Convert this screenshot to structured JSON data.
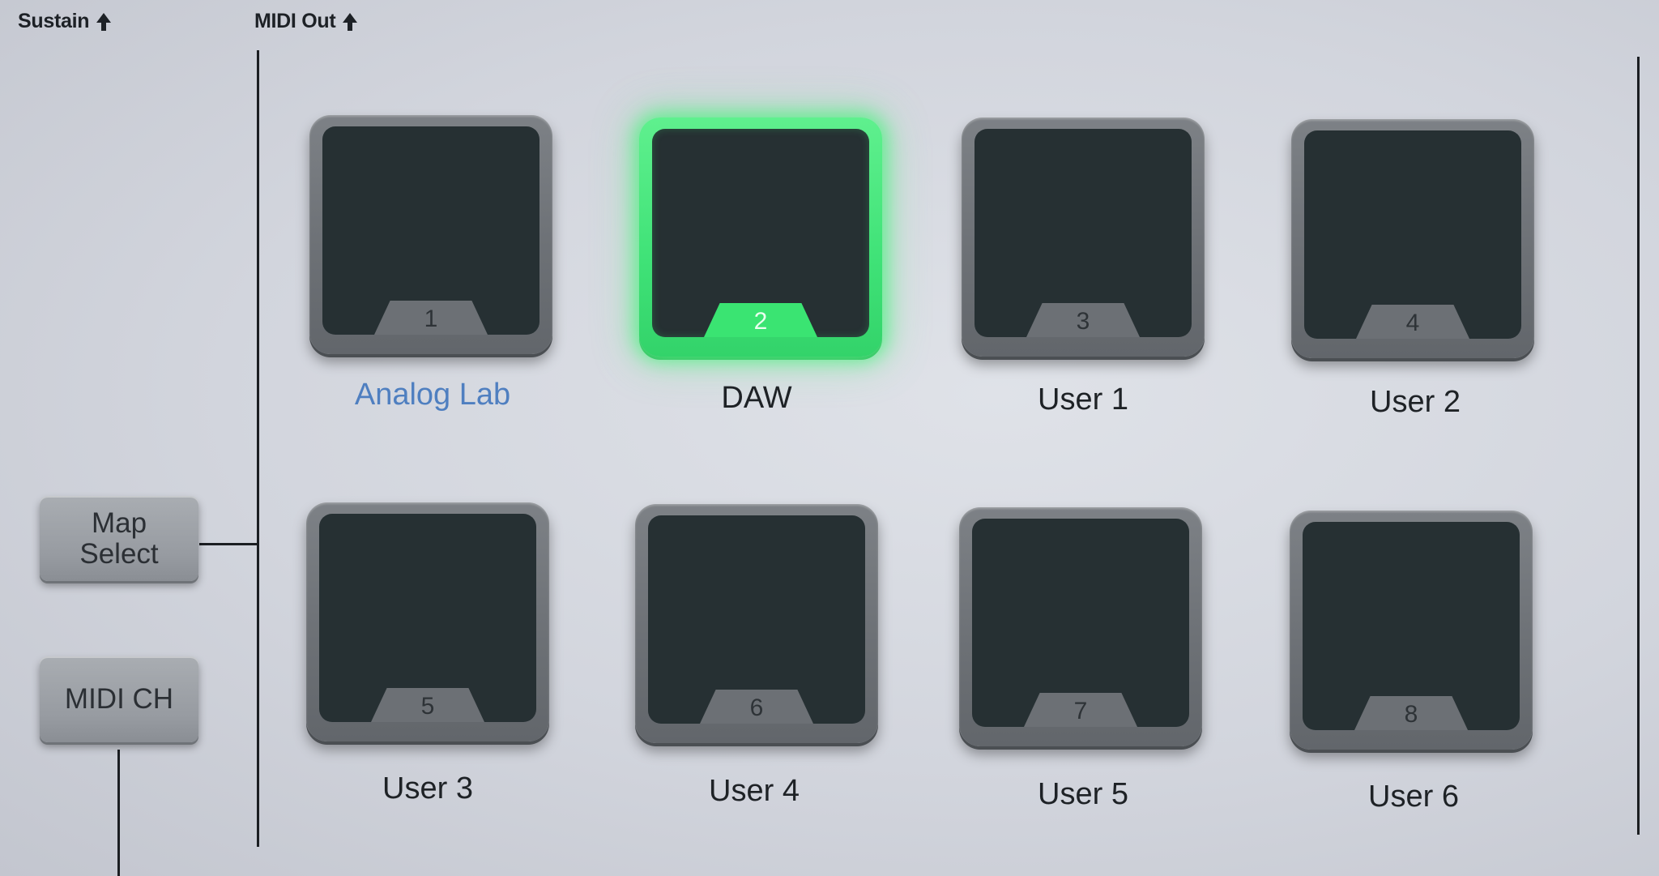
{
  "labels": {
    "sustain": "Sustain",
    "midi_out": "MIDI Out"
  },
  "buttons": {
    "map_select_line1": "Map",
    "map_select_line2": "Select",
    "midi_ch": "MIDI CH"
  },
  "pads": [
    {
      "number": "1",
      "label": "Analog Lab",
      "active": false,
      "label_color": "#4f7fc0"
    },
    {
      "number": "2",
      "label": "DAW",
      "active": true,
      "glow_color": "#4be67f"
    },
    {
      "number": "3",
      "label": "User 1",
      "active": false
    },
    {
      "number": "4",
      "label": "User 2",
      "active": false
    },
    {
      "number": "5",
      "label": "User 3",
      "active": false
    },
    {
      "number": "6",
      "label": "User 4",
      "active": false
    },
    {
      "number": "7",
      "label": "User 5",
      "active": false
    },
    {
      "number": "8",
      "label": "User 6",
      "active": false
    }
  ],
  "icons": {
    "sustain_arrow": "up-arrow-icon",
    "midi_out_arrow": "up-arrow-icon"
  }
}
